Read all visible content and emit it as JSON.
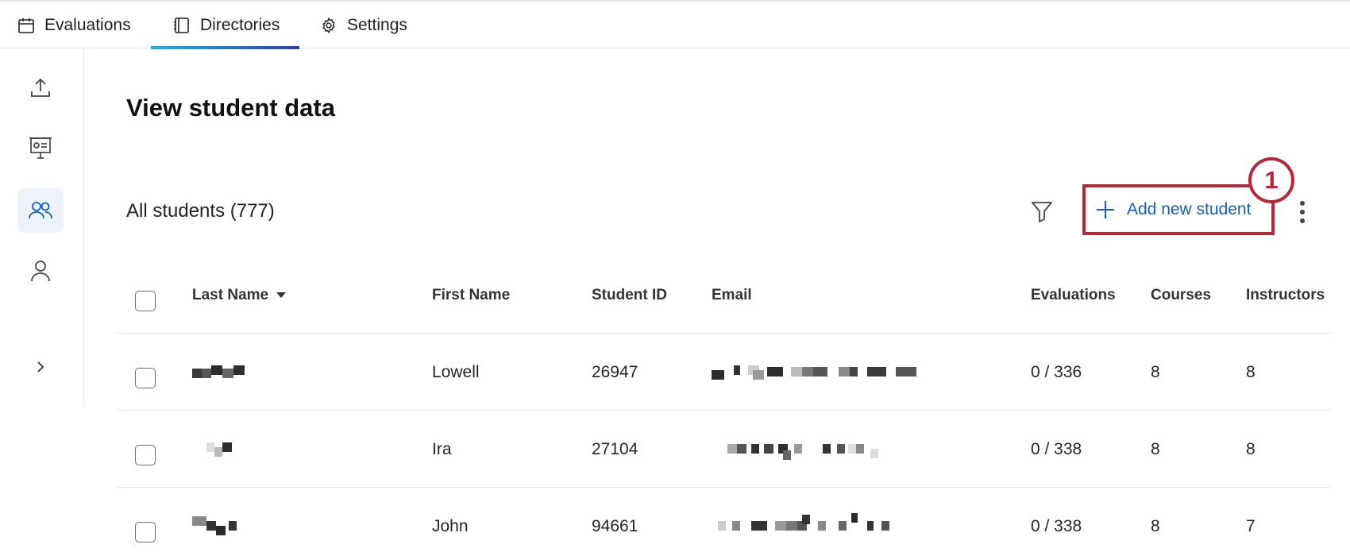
{
  "nav": {
    "tabs": [
      {
        "label": "Evaluations",
        "icon": "calendar-icon"
      },
      {
        "label": "Directories",
        "icon": "directory-icon",
        "active": true
      },
      {
        "label": "Settings",
        "icon": "gear-icon"
      }
    ]
  },
  "rail": {
    "items": [
      {
        "icon": "upload-icon"
      },
      {
        "icon": "presentation-icon"
      },
      {
        "icon": "students-icon",
        "active": true
      },
      {
        "icon": "person-icon"
      },
      {
        "icon": "chevron-right-icon"
      }
    ]
  },
  "page": {
    "title": "View student data",
    "count_label": "All students (777)",
    "add_button": "Add new student",
    "callout_number": "1"
  },
  "colors": {
    "accent_blue": "#1561b8",
    "callout_red": "#b3283a",
    "tab_gradient_start": "#1bb8d8",
    "tab_gradient_end": "#2a3fae"
  },
  "table": {
    "headers": {
      "last_name": "Last Name",
      "first_name": "First Name",
      "student_id": "Student ID",
      "email": "Email",
      "evaluations": "Evaluations",
      "courses": "Courses",
      "instructors": "Instructors"
    },
    "rows": [
      {
        "first_name": "Lowell",
        "student_id": "26947",
        "evaluations": "0 / 336",
        "courses": "8",
        "instructors": "8"
      },
      {
        "first_name": "Ira",
        "student_id": "27104",
        "evaluations": "0 / 338",
        "courses": "8",
        "instructors": "8"
      },
      {
        "first_name": "John",
        "student_id": "94661",
        "evaluations": "0 / 338",
        "courses": "8",
        "instructors": "7"
      }
    ]
  }
}
